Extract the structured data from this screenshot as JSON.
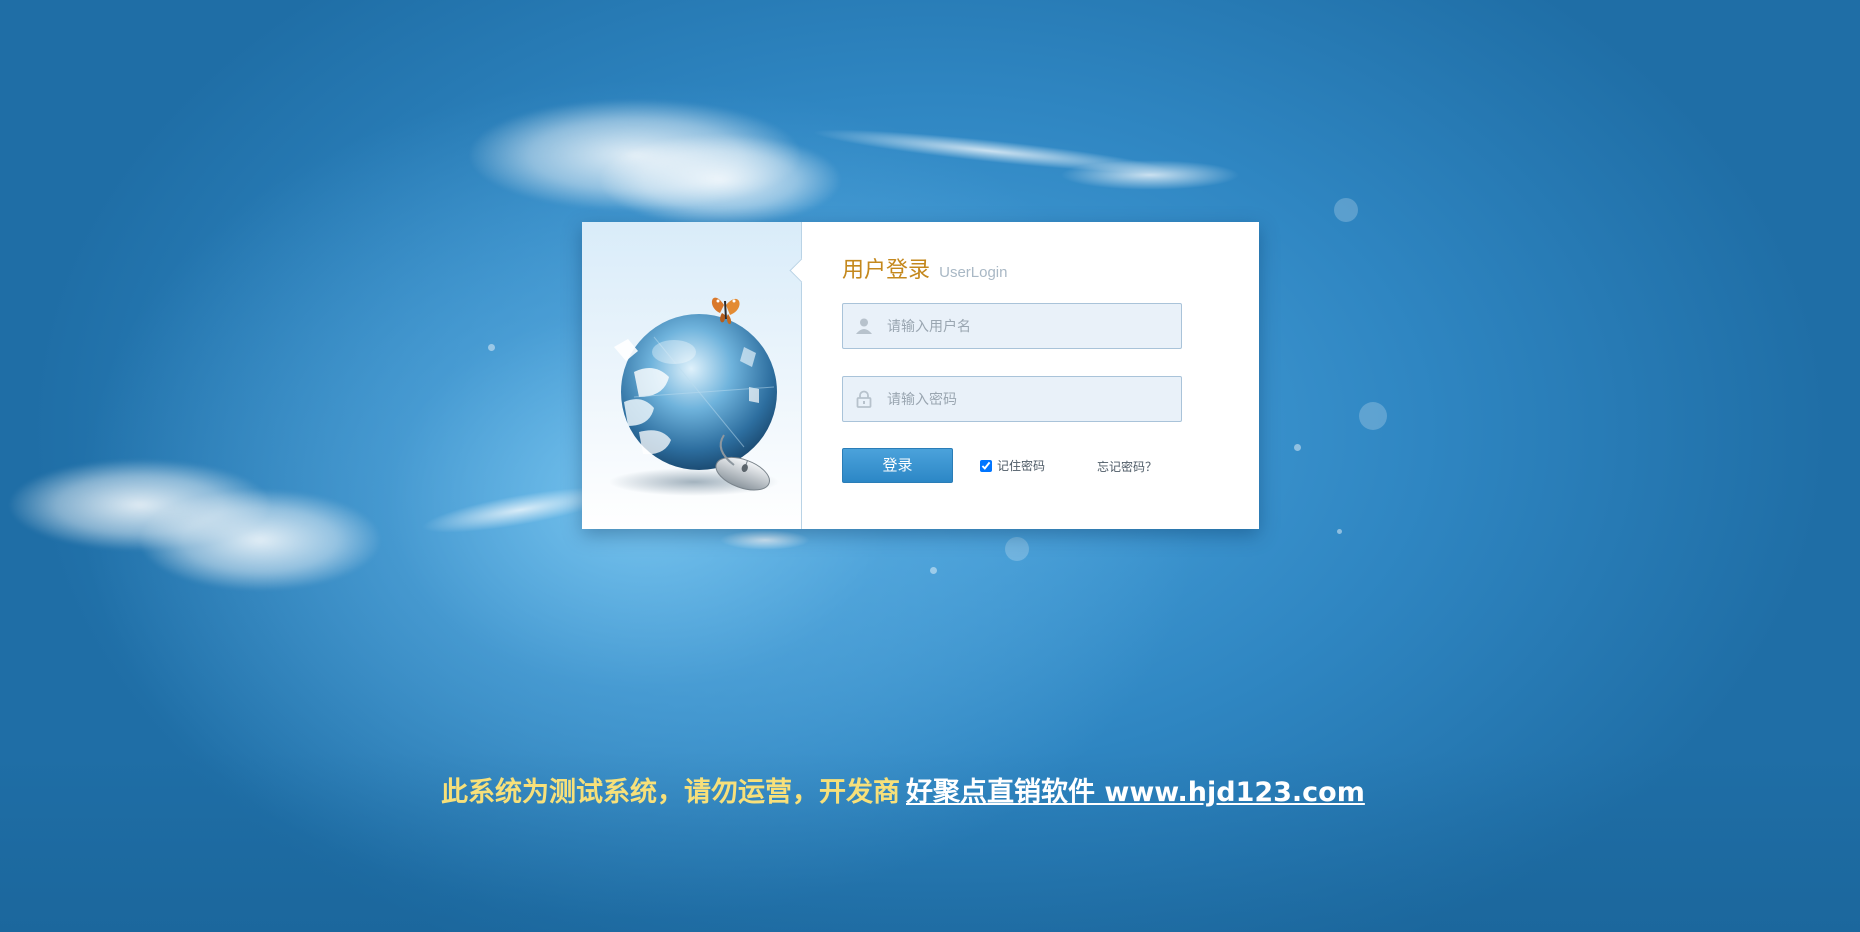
{
  "login": {
    "title_cn": "用户登录",
    "title_en": "UserLogin",
    "username_placeholder": "请输入用户名",
    "password_placeholder": "请输入密码",
    "username_value": "",
    "password_value": "",
    "submit_label": "登录",
    "remember_label": "记住密码",
    "remember_checked": true,
    "forgot_label": "忘记密码？"
  },
  "footer": {
    "notice": "此系统为测试系统，请勿运营，开发商",
    "link_text": "好聚点直销软件 www.hjd123.com"
  },
  "icons": {
    "username": "user-icon",
    "password": "lock-icon",
    "illustration": "globe-puzzle-illustration"
  },
  "colors": {
    "background": "#2f86c2",
    "title": "#c4881d",
    "button": "#3a94d1",
    "notice": "#f7e07a",
    "link": "#ffffff"
  }
}
